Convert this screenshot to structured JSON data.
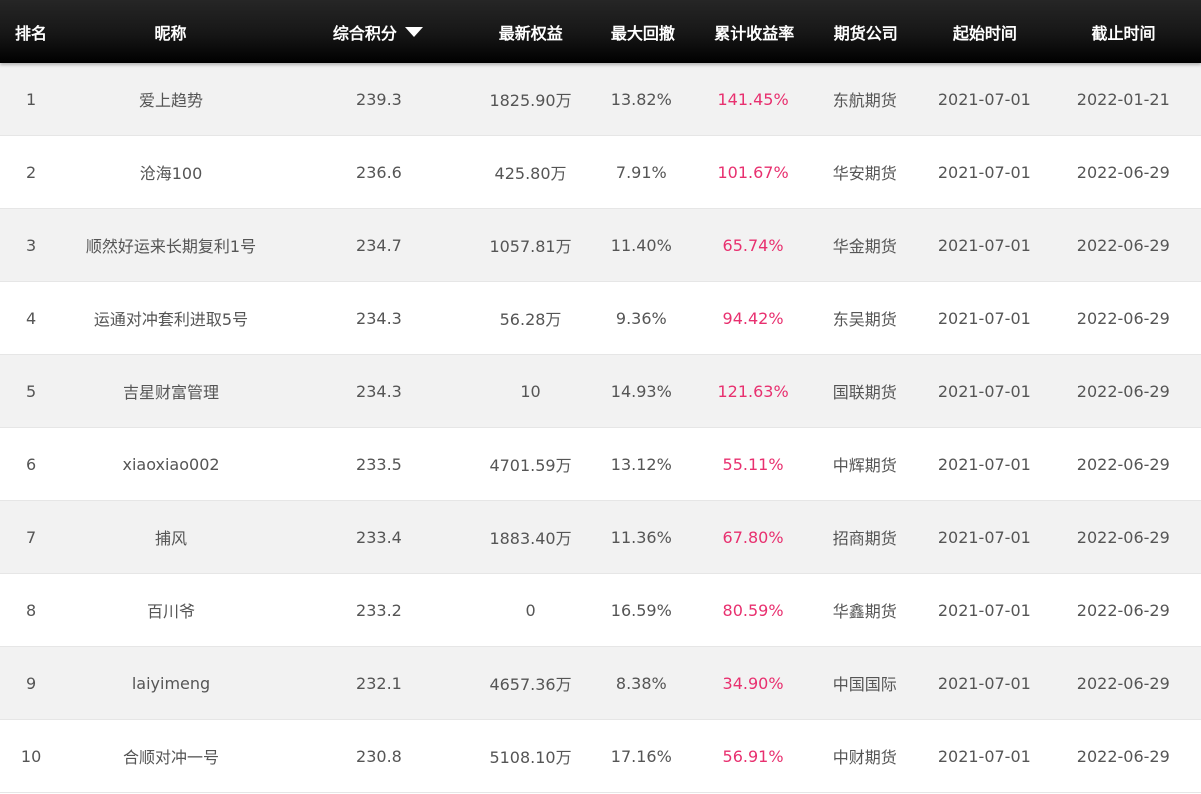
{
  "table": {
    "headers": {
      "rank": "排名",
      "name": "昵称",
      "score": "综合积分",
      "equity": "最新权益",
      "drawdown": "最大回撤",
      "return": "累计收益率",
      "broker": "期货公司",
      "start": "起始时间",
      "end": "截止时间"
    },
    "sort_icon": "triangle-down-icon",
    "colors": {
      "header_bg": "#111111",
      "header_text": "#ffffff",
      "row_odd_bg": "#f2f2f2",
      "row_even_bg": "#ffffff",
      "body_text": "#555555",
      "return_text": "#e8306f"
    },
    "rows": [
      {
        "rank": "1",
        "name": "爱上趋势",
        "score": "239.3",
        "equity": "1825.90万",
        "drawdown": "13.82%",
        "return": "141.45%",
        "broker": "东航期货",
        "start": "2021-07-01",
        "end": "2022-01-21"
      },
      {
        "rank": "2",
        "name": "沧海100",
        "score": "236.6",
        "equity": "425.80万",
        "drawdown": "7.91%",
        "return": "101.67%",
        "broker": "华安期货",
        "start": "2021-07-01",
        "end": "2022-06-29"
      },
      {
        "rank": "3",
        "name": "顺然好运来长期复利1号",
        "score": "234.7",
        "equity": "1057.81万",
        "drawdown": "11.40%",
        "return": "65.74%",
        "broker": "华金期货",
        "start": "2021-07-01",
        "end": "2022-06-29"
      },
      {
        "rank": "4",
        "name": "运通对冲套利进取5号",
        "score": "234.3",
        "equity": "56.28万",
        "drawdown": "9.36%",
        "return": "94.42%",
        "broker": "东吴期货",
        "start": "2021-07-01",
        "end": "2022-06-29"
      },
      {
        "rank": "5",
        "name": "吉星财富管理",
        "score": "234.3",
        "equity": "10",
        "drawdown": "14.93%",
        "return": "121.63%",
        "broker": "国联期货",
        "start": "2021-07-01",
        "end": "2022-06-29"
      },
      {
        "rank": "6",
        "name": "xiaoxiao002",
        "score": "233.5",
        "equity": "4701.59万",
        "drawdown": "13.12%",
        "return": "55.11%",
        "broker": "中辉期货",
        "start": "2021-07-01",
        "end": "2022-06-29"
      },
      {
        "rank": "7",
        "name": "捕风",
        "score": "233.4",
        "equity": "1883.40万",
        "drawdown": "11.36%",
        "return": "67.80%",
        "broker": "招商期货",
        "start": "2021-07-01",
        "end": "2022-06-29"
      },
      {
        "rank": "8",
        "name": "百川爷",
        "score": "233.2",
        "equity": "0",
        "drawdown": "16.59%",
        "return": "80.59%",
        "broker": "华鑫期货",
        "start": "2021-07-01",
        "end": "2022-06-29"
      },
      {
        "rank": "9",
        "name": "laiyimeng",
        "score": "232.1",
        "equity": "4657.36万",
        "drawdown": "8.38%",
        "return": "34.90%",
        "broker": "中国国际",
        "start": "2021-07-01",
        "end": "2022-06-29"
      },
      {
        "rank": "10",
        "name": "合顺对冲一号",
        "score": "230.8",
        "equity": "5108.10万",
        "drawdown": "17.16%",
        "return": "56.91%",
        "broker": "中财期货",
        "start": "2021-07-01",
        "end": "2022-06-29"
      }
    ]
  }
}
